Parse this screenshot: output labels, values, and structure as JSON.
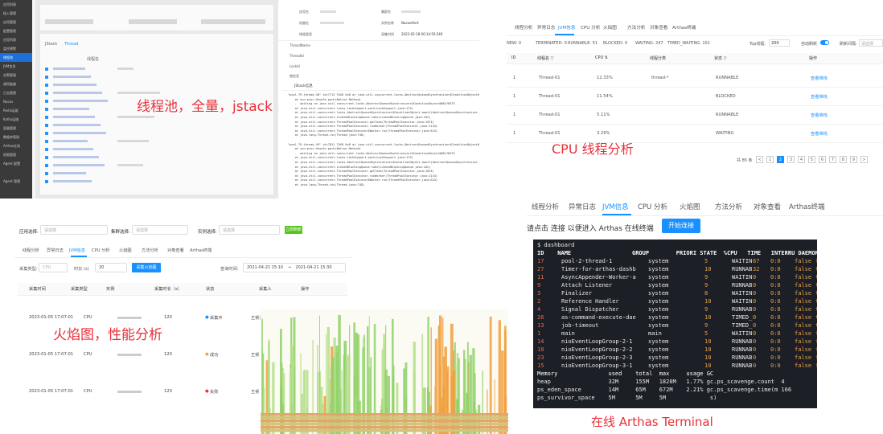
{
  "captions": {
    "c1": "线程池，全量，jstack",
    "c2": "CPU 线程分析",
    "c3": "火焰图，性能分析",
    "c4": "在线 Arthas Terminal"
  },
  "p1": {
    "side": [
      "应用列表",
      "接入管理",
      "应用管理",
      "配置管理",
      "应用列表",
      "监控预警",
      "线程池",
      "JVM信息",
      "告警管理",
      "调用链路",
      "日志管理",
      "Nacos",
      "Redis运维",
      "Kafka运维",
      "容器管理",
      "数据库管理",
      "Arthas在线",
      "权限管理",
      "Agent 配置",
      "",
      "Agent 管理"
    ],
    "tabs": [
      "JStack",
      "Thread"
    ],
    "head": "线程名",
    "btn": "刷新"
  },
  "p2": {
    "labels": [
      "应用名",
      "机器名",
      "线程类型",
      "ThreadName",
      "ThreadId",
      "LockId",
      "锁信息"
    ],
    "right_labels": [
      "集群名",
      "实例名称",
      "采集时间"
    ],
    "right_vals": [
      "",
      "NacosAlert",
      "2023-02-18 00:14:56.549"
    ],
    "jstack_title": "JStack信息",
    "code": [
      "\"pool-79-thread-48\" id=7713 TASK 0x8 at java.util.concurrent.locks.AbstractQueuedSynchronizer$ConditionObject@68c76575",
      "    at sun.misc.Unsafe.park(Native Method)",
      "    -  waiting on java.util.concurrent.locks.AbstractQueuedSynchronizer$ConditionObject@68c76575",
      "    at java.util.concurrent.locks.LockSupport.park(LockSupport.java:175)",
      "    at java.util.concurrent.locks.AbstractQueuedSynchronizer$ConditionObject.await(AbstractQueuedSynchronizer.java:2039)",
      "    at java.util.concurrent.LinkedBlockingQueue.take(LinkedBlockingQueue.java:442)",
      "    at java.util.concurrent.ThreadPoolExecutor.getTask(ThreadPoolExecutor.java:1074)",
      "    at java.util.concurrent.ThreadPoolExecutor.runWorker(ThreadPoolExecutor.java:1134)",
      "    at java.util.concurrent.ThreadPoolExecutor$Worker.run(ThreadPoolExecutor.java:624)",
      "    at java.lang.Thread.run(Thread.java:748)",
      "",
      "\"pool-79-thread-49\" id=7811 TASK 0x8 at java.util.concurrent.locks.AbstractQueuedSynchronizer$ConditionObject@68c76575",
      "    at sun.misc.Unsafe.park(Native Method)",
      "    -  waiting on java.util.concurrent.locks.AbstractQueuedSynchronizer$ConditionObject@68c76575",
      "    at java.util.concurrent.locks.LockSupport.park(LockSupport.java:175)",
      "    at java.util.concurrent.locks.AbstractQueuedSynchronizer$ConditionObject.await(AbstractQueuedSynchronizer.java:2039)",
      "    at java.util.concurrent.LinkedBlockingQueue.take(LinkedBlockingQueue.java:442)",
      "    at java.util.concurrent.ThreadPoolExecutor.getTask(ThreadPoolExecutor.java:1074)",
      "    at java.util.concurrent.ThreadPoolExecutor.runWorker(ThreadPoolExecutor.java:1134)",
      "    at java.util.concurrent.ThreadPoolExecutor$Worker.run(ThreadPoolExecutor.java:624)",
      "    at java.lang.Thread.run(Thread.java:748)"
    ]
  },
  "p3": {
    "tabs": [
      "线程分析",
      "异常日志",
      "JVM信息",
      "CPU 分析",
      "火焰图",
      "方法分析",
      "对象查看",
      "Arthas终端"
    ],
    "stats": [
      "NEW: 0",
      "TERMINATED: 0",
      "RUNNABLE: 51",
      "BLOCKED: 0",
      "WAITING: 247",
      "TIMED_WAITING: 101"
    ],
    "top_label": "Top线程:",
    "top_value": "200",
    "auto_label": "自动刷新",
    "interval_label": "刷新间隔:",
    "interval_ph": "请选择",
    "cols": [
      "ID",
      "线程名 ▽",
      "CPU ⇅",
      "线程分类",
      "状态 ▽",
      "操作"
    ],
    "rows": [
      [
        "1",
        "Thread-01",
        "12.33%",
        "thread-*",
        "RUNNABLE",
        "查看堆栈"
      ],
      [
        "1",
        "Thread-01",
        "11.54%",
        "",
        "BLOCKED",
        "查看堆栈"
      ],
      [
        "1",
        "Thread-01",
        "5.11%",
        "",
        "RUNNABLE",
        "查看堆栈"
      ],
      [
        "1",
        "Thread-01",
        "3.29%",
        "",
        "WAITING",
        "查看堆栈"
      ]
    ],
    "total": "共 85 条",
    "pages": [
      "<",
      "1",
      "2",
      "3",
      "4",
      "5",
      "6",
      "7",
      "8",
      "9",
      ">"
    ]
  },
  "p4": {
    "app_label": "应用选择:",
    "app_ph": "请选择",
    "cluster_label": "集群选择:",
    "cluster_ph": "请选择",
    "inst_label": "实例选择:",
    "inst_ph": "请选择",
    "refresh": "立即刷新",
    "tabs": [
      "线程分析",
      "异常日志",
      "JVM信息",
      "CPU 分析",
      "火焰图",
      "方法分析",
      "对象查看",
      "Arthas终端"
    ],
    "type_label": "采集类型:",
    "type_val": "CPU",
    "dur_label": "时长 (s)",
    "dur_val": "20",
    "start_btn": "采集火焰图",
    "time_label": "查询时间:",
    "time_from": "2021-04-21 15:10",
    "time_to": "2021-04-21 15:30",
    "cols": [
      "采集时间",
      "采集类型",
      "实例",
      "采集时长（s）",
      "状态",
      "采集人",
      "操作"
    ],
    "rows": [
      [
        "2023-01-05 17:07:01",
        "CPU",
        "",
        "120",
        "采集中",
        "王祯涛",
        "查看火焰图",
        "查看分析报告"
      ],
      [
        "2023-01-05 17:07:01",
        "CPU",
        "",
        "120",
        "成功",
        "王祯",
        ""
      ],
      [
        "2023-01-05 17:07:01",
        "CPU",
        "",
        "120",
        "失败",
        "王祯",
        ""
      ]
    ]
  },
  "p5": {
    "tabs": [
      "线程分析",
      "异常日志",
      "JVM信息",
      "CPU 分析",
      "火焰图",
      "方法分析",
      "对象查看",
      "Arthas终端"
    ],
    "hint": "请点击 连接 以便进入 Arthas 在线终端",
    "connect": "开始连接",
    "prompt": "$ dashboard",
    "header": "ID    NAME                  GROUP        PRIORI STATE  %CPU   TIME   INTERRU DAEMON",
    "rows": [
      [
        "17",
        "pool-2-thread-1",
        "system",
        "5",
        "WAITIN",
        "67",
        "0:0",
        "false",
        "false"
      ],
      [
        "27",
        "Timer-for-arthas-dashb",
        "system",
        "10",
        "RUNNAB",
        "32",
        "0:0",
        "false",
        "true"
      ],
      [
        "11",
        "AsyncAppender-Worker-a",
        "system",
        "9",
        "WAITIN",
        "0",
        "0:0",
        "false",
        "true"
      ],
      [
        "9",
        "Attach Listener",
        "system",
        "9",
        "RUNNAB",
        "0",
        "0:0",
        "false",
        "true"
      ],
      [
        "3",
        "Finalizer",
        "system",
        "8",
        "WAITIN",
        "0",
        "0:0",
        "false",
        "true"
      ],
      [
        "2",
        "Reference Handler",
        "system",
        "10",
        "WAITIN",
        "0",
        "0:0",
        "false",
        "true"
      ],
      [
        "4",
        "Signal Dispatcher",
        "system",
        "9",
        "RUNNAB",
        "0",
        "0:0",
        "false",
        "true"
      ],
      [
        "26",
        "as-command-execute-dae",
        "system",
        "10",
        "TIMED_",
        "0",
        "0:0",
        "false",
        "true"
      ],
      [
        "13",
        "job-timeout",
        "system",
        "9",
        "TIMED_",
        "0",
        "0:0",
        "false",
        "true"
      ],
      [
        "1",
        "main",
        "main",
        "5",
        "WAITIN",
        "0",
        "0:0",
        "false",
        "false"
      ],
      [
        "14",
        "nioEventLoopGroup-2-1",
        "system",
        "10",
        "RUNNAB",
        "0",
        "0:0",
        "false",
        "false"
      ],
      [
        "18",
        "nioEventLoopGroup-2-2",
        "system",
        "10",
        "RUNNAB",
        "0",
        "0:0",
        "false",
        "false"
      ],
      [
        "23",
        "nioEventLoopGroup-2-3",
        "system",
        "10",
        "RUNNAB",
        "0",
        "0:0",
        "false",
        "false"
      ],
      [
        "15",
        "nioEventLoopGroup-3-1",
        "system",
        "10",
        "RUNNAB",
        "0",
        "0:0",
        "false",
        "false"
      ]
    ],
    "mem": [
      "Memory               used    total  max     usage GC",
      "heap                 32M     155M   1820M   1.77% gc.ps_scavenge.count  4",
      "ps_eden_space        14M     65M    672M    2.21% gc.ps_scavenge.time(m 166",
      "ps_survivor_space    5M      5M     5M             s)"
    ]
  },
  "colors": {
    "accent": "#1890ff",
    "caption": "#e8303a",
    "term_bg": "#1c1f26",
    "term_id": "#e86b4a",
    "term_name": "#e8e8e8",
    "term_val": "#e8a04a",
    "term_prio": "#e8a04a",
    "flame_green": "#8fd16a",
    "flame_orange": "#f0a040"
  }
}
